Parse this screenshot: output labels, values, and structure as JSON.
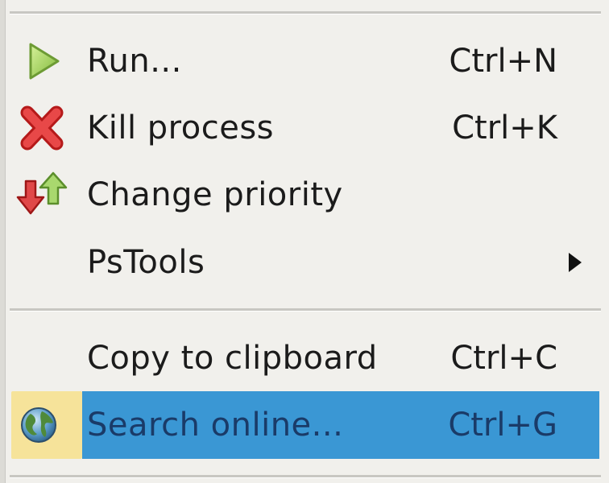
{
  "menu": {
    "items": [
      {
        "label": "Run...",
        "shortcut": "Ctrl+N",
        "icon": "play-icon"
      },
      {
        "label": "Kill process",
        "shortcut": "Ctrl+K",
        "icon": "kill-x-icon"
      },
      {
        "label": "Change priority",
        "shortcut": "",
        "icon": "priority-arrows-icon"
      },
      {
        "label": "PsTools",
        "shortcut": "",
        "icon": "submenu-arrow-icon"
      },
      {
        "label": "Copy to clipboard",
        "shortcut": "Ctrl+C",
        "icon": ""
      },
      {
        "label": "Search online...",
        "shortcut": "Ctrl+G",
        "icon": "globe-icon",
        "highlighted": true
      }
    ]
  },
  "colors": {
    "menu_background": "#f1f0ec",
    "highlight": "#3a97d4",
    "highlight_text": "#1a3b68",
    "icon_highlight": "#f6e39a"
  }
}
